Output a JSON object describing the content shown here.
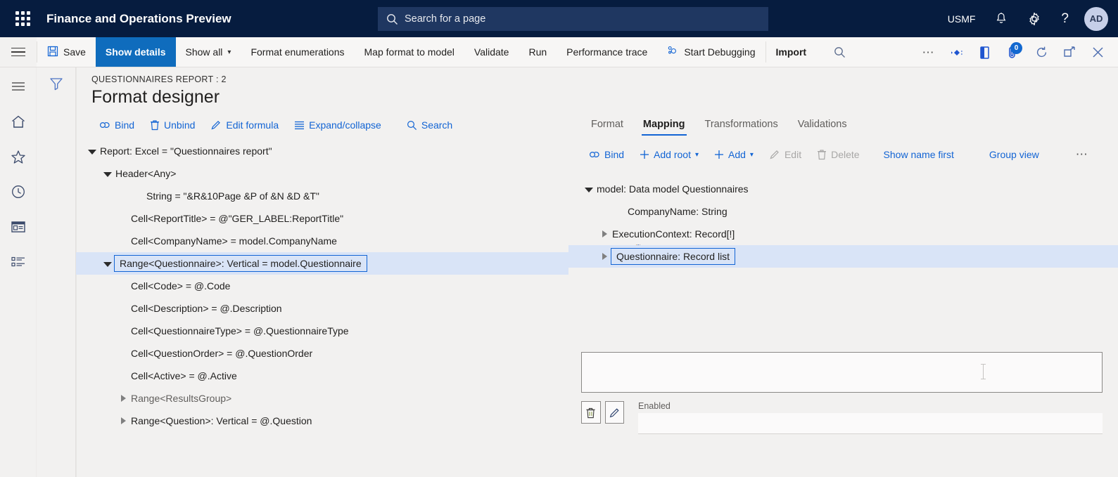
{
  "topnav": {
    "waffle_label": "app-launcher",
    "app_title": "Finance and Operations Preview",
    "search_placeholder": "Search for a page",
    "company": "USMF",
    "notifications_icon": "bell-icon",
    "settings_icon": "gear-icon",
    "help_icon": "question-mark-icon",
    "avatar_initials": "AD"
  },
  "actionpane": {
    "save_label": "Save",
    "show_details_label": "Show details",
    "show_all_label": "Show all",
    "format_enumerations_label": "Format enumerations",
    "map_format_to_model_label": "Map format to model",
    "validate_label": "Validate",
    "run_label": "Run",
    "performance_trace_label": "Performance trace",
    "start_debugging_label": "Start Debugging",
    "import_label": "Import",
    "search_icon": "search-icon",
    "overflow_icon": "ellipsis-icon",
    "share_icon": "share-icon",
    "office_icon": "office-app-icon",
    "attachments_icon": "attachment-icon",
    "attachments_count": "0",
    "refresh_icon": "refresh-icon",
    "popout_icon": "open-in-new-window-icon",
    "close_icon": "close-icon"
  },
  "leftrail": {
    "items": [
      {
        "name": "hamburger-icon"
      },
      {
        "name": "home-icon"
      },
      {
        "name": "favorites-star-icon"
      },
      {
        "name": "recent-clock-icon"
      },
      {
        "name": "workspaces-icon"
      },
      {
        "name": "modules-list-icon"
      }
    ]
  },
  "page": {
    "filter_icon": "filter-icon",
    "caption_sub": "QUESTIONNAIRES REPORT : 2",
    "caption_title": "Format designer"
  },
  "format_toolbar": {
    "bind_label": "Bind",
    "unbind_label": "Unbind",
    "edit_formula_label": "Edit formula",
    "expand_collapse_label": "Expand/collapse",
    "search_label": "Search"
  },
  "format_tree": [
    {
      "label": "Report: Excel = \"Questionnaires report\"",
      "indent": 0,
      "toggle": "down",
      "selected": false,
      "boxed": false,
      "dim": false
    },
    {
      "label": "Header<Any>",
      "indent": 1,
      "toggle": "down",
      "selected": false,
      "boxed": false,
      "dim": false
    },
    {
      "label": "String = \"&R&10Page &P of &N &D &T\"",
      "indent": 3,
      "toggle": "none",
      "selected": false,
      "boxed": false,
      "dim": false
    },
    {
      "label": "Cell<ReportTitle> = @\"GER_LABEL:ReportTitle\"",
      "indent": 2,
      "toggle": "none",
      "selected": false,
      "boxed": false,
      "dim": false
    },
    {
      "label": "Cell<CompanyName> = model.CompanyName",
      "indent": 2,
      "toggle": "none",
      "selected": false,
      "boxed": false,
      "dim": false
    },
    {
      "label": "Range<Questionnaire>: Vertical = model.Questionnaire",
      "indent": 1,
      "toggle": "down",
      "selected": true,
      "boxed": true,
      "dim": false
    },
    {
      "label": "Cell<Code> = @.Code",
      "indent": 2,
      "toggle": "none",
      "selected": false,
      "boxed": false,
      "dim": false
    },
    {
      "label": "Cell<Description> = @.Description",
      "indent": 2,
      "toggle": "none",
      "selected": false,
      "boxed": false,
      "dim": false
    },
    {
      "label": "Cell<QuestionnaireType> = @.QuestionnaireType",
      "indent": 2,
      "toggle": "none",
      "selected": false,
      "boxed": false,
      "dim": false
    },
    {
      "label": "Cell<QuestionOrder> = @.QuestionOrder",
      "indent": 2,
      "toggle": "none",
      "selected": false,
      "boxed": false,
      "dim": false
    },
    {
      "label": "Cell<Active> = @.Active",
      "indent": 2,
      "toggle": "none",
      "selected": false,
      "boxed": false,
      "dim": false
    },
    {
      "label": "Range<ResultsGroup>",
      "indent": 2,
      "toggle": "right",
      "selected": false,
      "boxed": false,
      "dim": true
    },
    {
      "label": "Range<Question>: Vertical = @.Question",
      "indent": 2,
      "toggle": "right",
      "selected": false,
      "boxed": false,
      "dim": false
    }
  ],
  "right_tabs": [
    {
      "label": "Format",
      "active": false
    },
    {
      "label": "Mapping",
      "active": true
    },
    {
      "label": "Transformations",
      "active": false
    },
    {
      "label": "Validations",
      "active": false
    }
  ],
  "mapping_toolbar": {
    "bind_label": "Bind",
    "add_root_label": "Add root",
    "add_label": "Add",
    "edit_label": "Edit",
    "delete_label": "Delete",
    "show_name_first_label": "Show name first",
    "group_view_label": "Group view",
    "overflow_label": "⋯"
  },
  "mapping_tree": [
    {
      "label": "model: Data model Questionnaires",
      "indent": 0,
      "toggle": "down",
      "selected": false,
      "boxed": false
    },
    {
      "label": "CompanyName: String",
      "indent": 2,
      "toggle": "none",
      "selected": false,
      "boxed": false
    },
    {
      "label": "ExecutionContext: Record[!]",
      "indent": 1,
      "toggle": "right",
      "selected": false,
      "boxed": false
    },
    {
      "label": "Questionnaire: Record list",
      "indent": 1,
      "toggle": "right",
      "selected": true,
      "boxed": true
    }
  ],
  "details": {
    "formula_value": "",
    "delete_icon": "trash-icon",
    "edit_icon": "pencil-icon",
    "enabled_label": "Enabled",
    "enabled_value": ""
  },
  "colors": {
    "nav_bg": "#061c3f",
    "accent": "#0f6cbd",
    "link": "#1264d4",
    "selection": "#d9e4f7",
    "page_bg": "#f2f1f0"
  }
}
